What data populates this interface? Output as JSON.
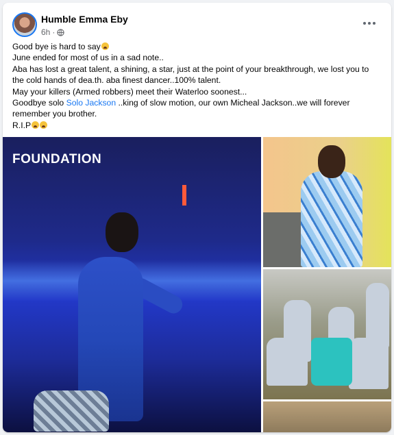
{
  "post": {
    "author": "Humble Emma Eby",
    "time": "6h",
    "separator": "·",
    "privacy_icon": "globe-icon",
    "more_icon": "more-horizontal-icon",
    "lines": {
      "l1": "Good bye is hard to say",
      "l2": "June ended for most of us in a sad note..",
      "l3": "Aba has lost a great talent, a shining, a star, just at the point of your breakthrough, we lost you to the cold hands of dea.th. aba finest dancer..100% talent.",
      "l4": "May your killers (Armed robbers) meet their Waterloo soonest...",
      "l5_pre": "Goodbye solo ",
      "l5_link": "Solo Jackson",
      "l5_post": " ..king of slow motion, our own Micheal Jackson..we will forever remember you brother.",
      "l6": "R.I.P"
    },
    "emoji_icon": "crying-face-icon"
  },
  "images": {
    "main_banner_text": "FOUNDATION"
  },
  "colors": {
    "link": "#1877f2",
    "meta": "#65676b",
    "background": "#f0f2f5"
  }
}
